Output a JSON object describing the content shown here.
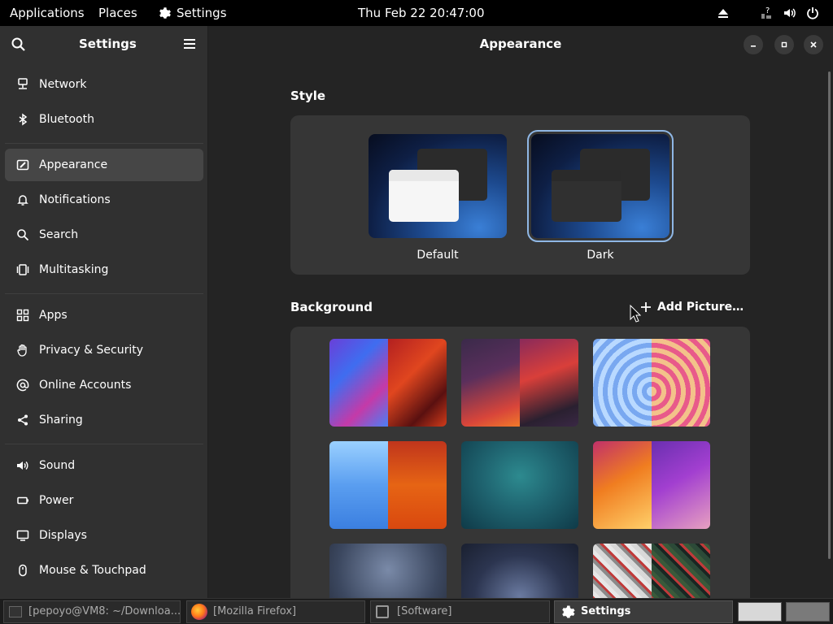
{
  "topbar": {
    "applications": "Applications",
    "places": "Places",
    "settings": "Settings",
    "datetime": "Thu Feb 22  20:47:00",
    "icons": [
      "eject-icon",
      "network-help-icon",
      "volume-icon",
      "power-icon"
    ]
  },
  "sidebar": {
    "title": "Settings",
    "items": [
      {
        "label": "Network",
        "icon": "network-icon"
      },
      {
        "label": "Bluetooth",
        "icon": "bluetooth-icon"
      },
      {
        "label": "Appearance",
        "icon": "appearance-icon",
        "active": true
      },
      {
        "label": "Notifications",
        "icon": "bell-icon"
      },
      {
        "label": "Search",
        "icon": "search-icon"
      },
      {
        "label": "Multitasking",
        "icon": "multitasking-icon"
      },
      {
        "label": "Apps",
        "icon": "apps-grid-icon"
      },
      {
        "label": "Privacy & Security",
        "icon": "hand-icon"
      },
      {
        "label": "Online Accounts",
        "icon": "at-sign-icon"
      },
      {
        "label": "Sharing",
        "icon": "share-icon"
      },
      {
        "label": "Sound",
        "icon": "speaker-icon"
      },
      {
        "label": "Power",
        "icon": "battery-icon"
      },
      {
        "label": "Displays",
        "icon": "display-icon"
      },
      {
        "label": "Mouse & Touchpad",
        "icon": "mouse-icon"
      }
    ]
  },
  "content": {
    "title": "Appearance",
    "style_title": "Style",
    "style_options": [
      {
        "label": "Default",
        "selected": false
      },
      {
        "label": "Dark",
        "selected": true
      }
    ],
    "background_title": "Background",
    "add_picture": "Add Picture…"
  },
  "colors": {
    "accent_selection": "#8fb7e5",
    "window_bg": "#242424",
    "sidebar_bg": "#303030",
    "card_bg": "#363636"
  },
  "taskbar": {
    "tasks": [
      {
        "label": "[pepoyo@VM8: ~/Downloa...",
        "icon": "terminal-icon"
      },
      {
        "label": "[Mozilla Firefox]",
        "icon": "firefox-icon"
      },
      {
        "label": "[Software]",
        "icon": "software-icon"
      },
      {
        "label": "Settings",
        "icon": "gear-icon",
        "active": true
      }
    ]
  }
}
